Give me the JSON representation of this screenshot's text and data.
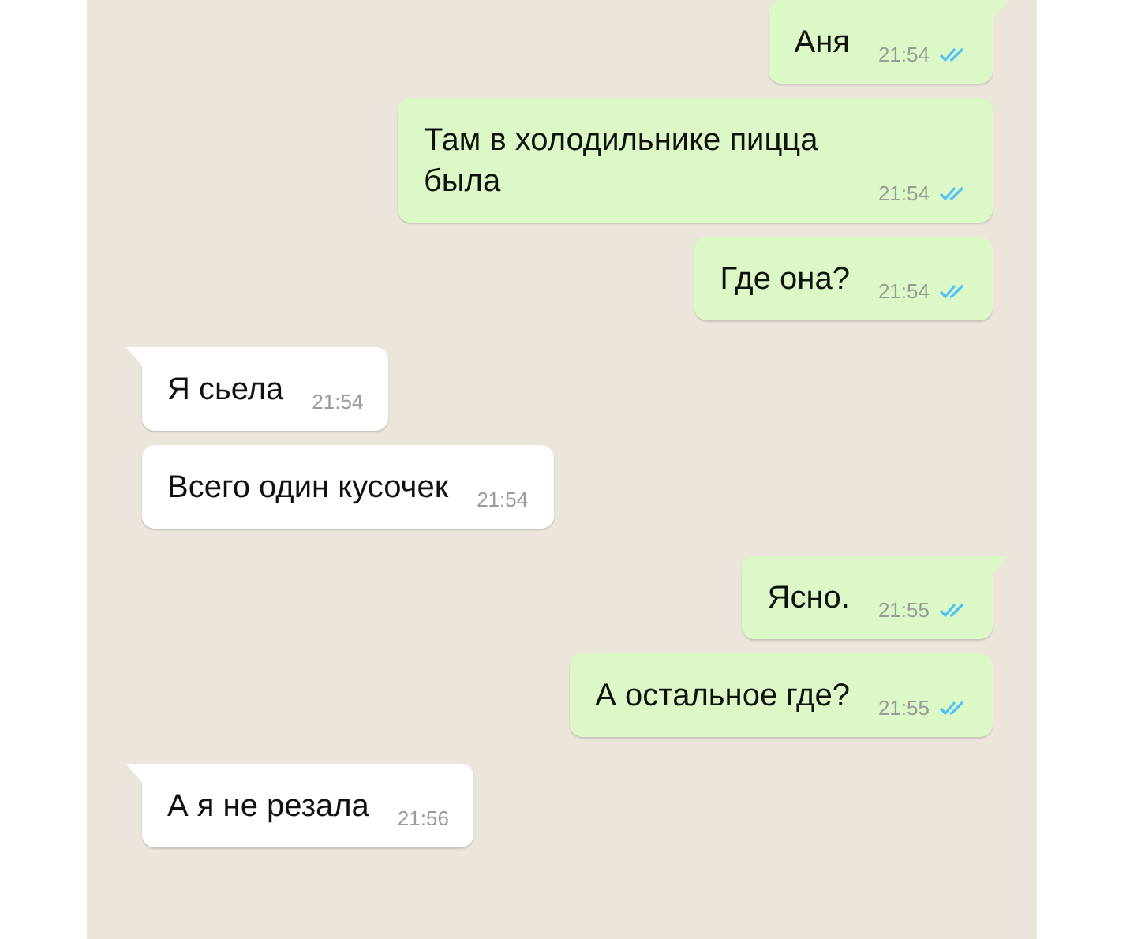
{
  "messages": [
    {
      "kind": "out",
      "text": "Аня",
      "time": "21:54",
      "read": true,
      "tail": true
    },
    {
      "kind": "out",
      "text": "Там в холодильнике пицца была",
      "time": "21:54",
      "read": true,
      "tail": false
    },
    {
      "kind": "out",
      "text": "Где она?",
      "time": "21:54",
      "read": true,
      "tail": false
    },
    {
      "kind": "in",
      "text": "Я сьела",
      "time": "21:54",
      "tail": true
    },
    {
      "kind": "in",
      "text": "Всего один кусочек",
      "time": "21:54",
      "tail": false
    },
    {
      "kind": "out",
      "text": "Ясно.",
      "time": "21:55",
      "read": true,
      "tail": true
    },
    {
      "kind": "out",
      "text": "А остальное где?",
      "time": "21:55",
      "read": true,
      "tail": false
    },
    {
      "kind": "in",
      "text": "А я не резала",
      "time": "21:56",
      "tail": true
    }
  ]
}
